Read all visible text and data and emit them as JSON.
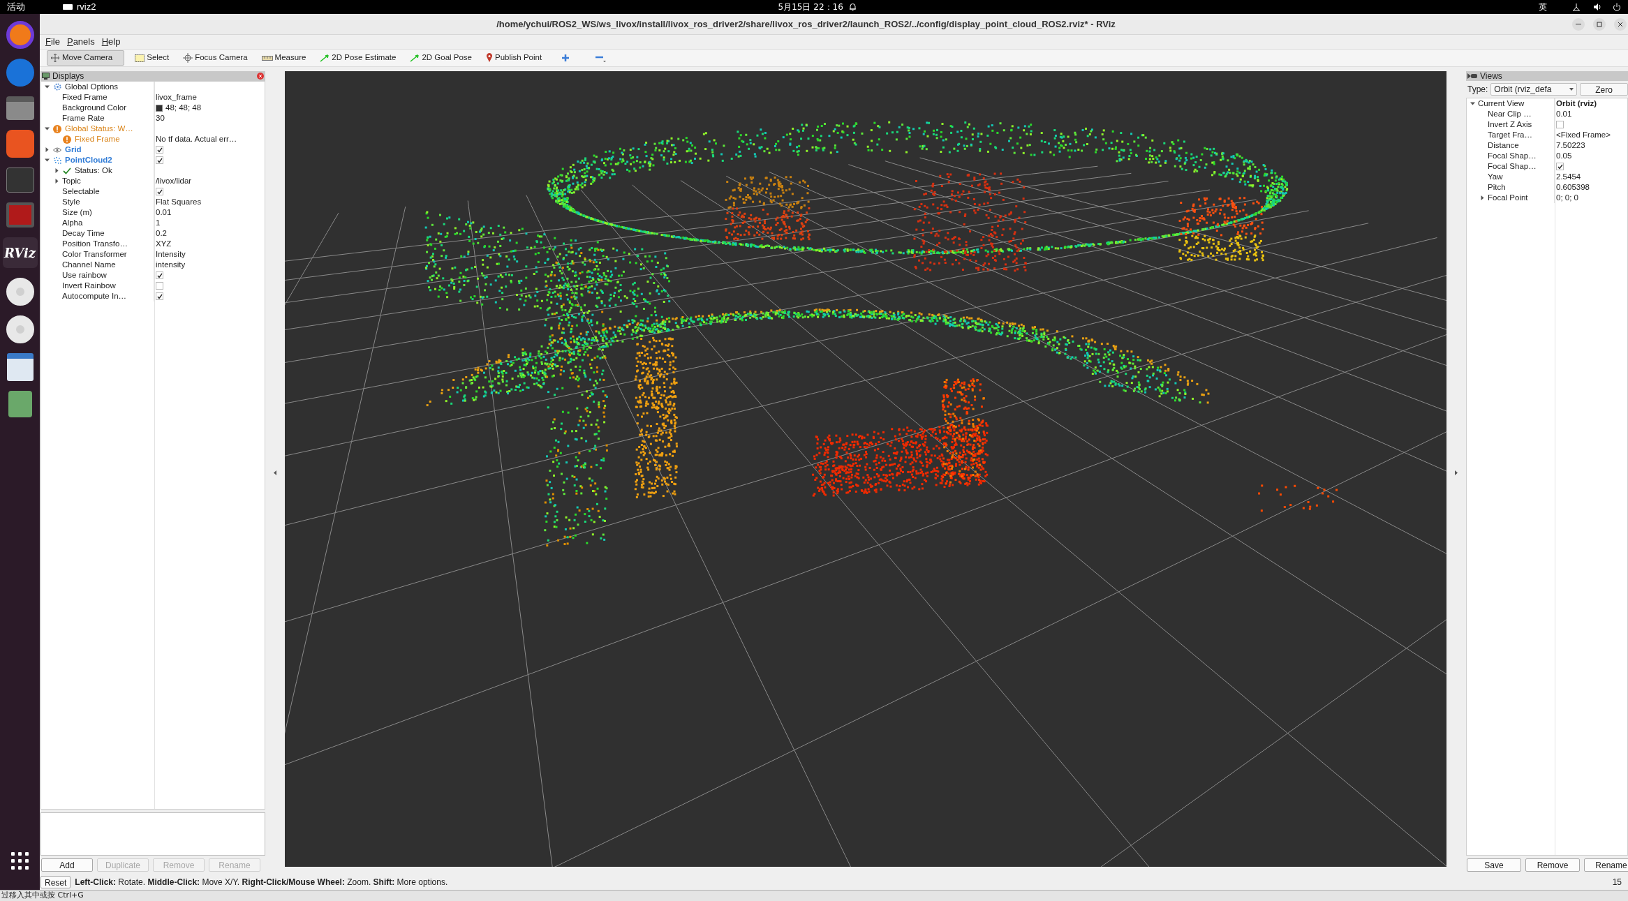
{
  "top_bar": {
    "activities": "活动",
    "app_name": "rviz2",
    "clock": "5月15日  22：16",
    "input_method": "英"
  },
  "dock": {
    "rviz_label": "RViz"
  },
  "window": {
    "title": "/home/ychui/ROS2_WS/ws_livox/install/livox_ros_driver2/share/livox_ros_driver2/launch_ROS2/../config/display_point_cloud_ROS2.rviz* - RViz"
  },
  "menu": [
    "File",
    "Panels",
    "Help"
  ],
  "toolbar": [
    {
      "kind": "move",
      "label": "Move Camera",
      "selected": true
    },
    {
      "kind": "select",
      "label": "Select",
      "selected": false
    },
    {
      "kind": "focus",
      "label": "Focus Camera",
      "selected": false
    },
    {
      "kind": "measure",
      "label": "Measure",
      "selected": false
    },
    {
      "kind": "pose",
      "label": "2D Pose Estimate",
      "selected": false
    },
    {
      "kind": "pose",
      "label": "2D Goal Pose",
      "selected": false
    },
    {
      "kind": "point",
      "label": "Publish Point",
      "selected": false
    },
    {
      "kind": "add",
      "selected": false
    },
    {
      "kind": "remove",
      "selected": false
    }
  ],
  "displays": {
    "title": "Displays",
    "tree": [
      {
        "name": "Global Options",
        "kind": "options",
        "expanded": true,
        "children": [
          {
            "name": "Fixed Frame",
            "value": "livox_frame"
          },
          {
            "name": "Background Color",
            "value": "48; 48; 48",
            "color": "#303030"
          },
          {
            "name": "Frame Rate",
            "value": "30"
          }
        ]
      },
      {
        "name": "Global Status: W…",
        "kind": "warning",
        "expanded": true,
        "children": [
          {
            "name": "Fixed Frame",
            "kind": "warning",
            "value": "No tf data.  Actual err…"
          }
        ]
      },
      {
        "name": "Grid",
        "kind": "grid",
        "expanded": false,
        "checked": true
      },
      {
        "name": "PointCloud2",
        "kind": "pointcloud",
        "expanded": true,
        "checked": true,
        "children": [
          {
            "name": "Status: Ok",
            "kind": "ok",
            "expanded": false
          },
          {
            "name": "Topic",
            "value": "/livox/lidar",
            "expanded": false
          },
          {
            "name": "Selectable",
            "checked": true
          },
          {
            "name": "Style",
            "value": "Flat Squares"
          },
          {
            "name": "Size (m)",
            "value": "0.01"
          },
          {
            "name": "Alpha",
            "value": "1"
          },
          {
            "name": "Decay Time",
            "value": "0.2"
          },
          {
            "name": "Position Transfo…",
            "value": "XYZ"
          },
          {
            "name": "Color Transformer",
            "value": "Intensity"
          },
          {
            "name": "Channel Name",
            "value": "intensity"
          },
          {
            "name": "Use rainbow",
            "checked": true
          },
          {
            "name": "Invert Rainbow",
            "checked": false
          },
          {
            "name": "Autocompute In…",
            "checked": true
          }
        ]
      }
    ],
    "buttons": [
      {
        "label": "Add",
        "disabled": false
      },
      {
        "label": "Duplicate",
        "disabled": true
      },
      {
        "label": "Remove",
        "disabled": true
      },
      {
        "label": "Rename",
        "disabled": true
      }
    ]
  },
  "views": {
    "title": "Views",
    "type_label": "Type:",
    "type_value": "Orbit (rviz_defa",
    "zero": "Zero",
    "tree": [
      {
        "name": "Current View",
        "value": "Orbit (rviz)",
        "expanded": true,
        "children": [
          {
            "name": "Near Clip …",
            "value": "0.01"
          },
          {
            "name": "Invert Z Axis",
            "checked": false
          },
          {
            "name": "Target Fra…",
            "value": "<Fixed Frame>"
          },
          {
            "name": "Distance",
            "value": "7.50223"
          },
          {
            "name": "Focal Shap…",
            "value": "0.05"
          },
          {
            "name": "Focal Shap…",
            "checked": true
          },
          {
            "name": "Yaw",
            "value": "2.5454"
          },
          {
            "name": "Pitch",
            "value": "0.605398"
          },
          {
            "name": "Focal Point",
            "value": "0; 0; 0",
            "expanded": false
          }
        ]
      }
    ],
    "buttons": [
      "Save",
      "Remove",
      "Rename"
    ]
  },
  "status_bar": {
    "reset": "Reset",
    "hint": "**Left-Click:** Rotate. **Middle-Click:** Move X/Y. **Right-Click/Mouse Wheel:** Zoom. **Shift:** More options.",
    "fps": "15"
  },
  "vm_bar": {
    "hint": "过移入其中或按 Ctrl+G"
  }
}
